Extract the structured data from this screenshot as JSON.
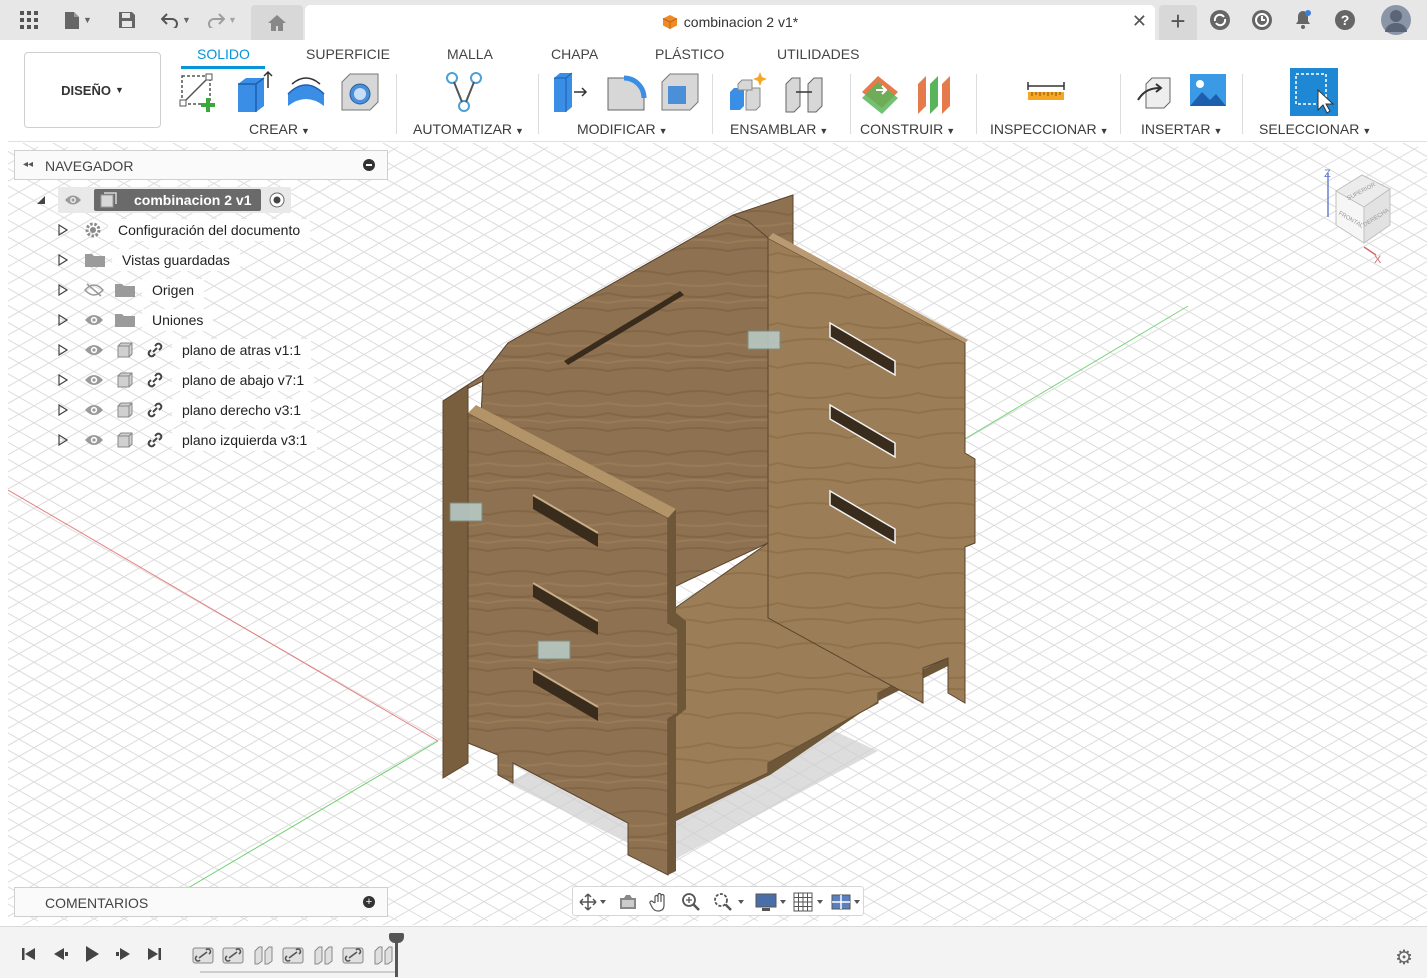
{
  "titlebar": {
    "document_title": "combinacion 2 v1*",
    "close_symbol": "✕",
    "add_tab_symbol": "+"
  },
  "ribbon": {
    "workspace_label": "DISEÑO",
    "tabs": [
      {
        "label": "SOLIDO",
        "active": true
      },
      {
        "label": "SUPERFICIE",
        "active": false
      },
      {
        "label": "MALLA",
        "active": false
      },
      {
        "label": "CHAPA",
        "active": false
      },
      {
        "label": "PLÁSTICO",
        "active": false
      },
      {
        "label": "UTILIDADES",
        "active": false
      }
    ],
    "groups": [
      {
        "label": "CREAR"
      },
      {
        "label": "AUTOMATIZAR"
      },
      {
        "label": "MODIFICAR"
      },
      {
        "label": "ENSAMBLAR"
      },
      {
        "label": "CONSTRUIR"
      },
      {
        "label": "INSPECCIONAR"
      },
      {
        "label": "INSERTAR"
      },
      {
        "label": "SELECCIONAR"
      }
    ],
    "accent": "#0696d7"
  },
  "navigator": {
    "title": "NAVEGADOR",
    "root": "combinacion 2 v1",
    "items": [
      {
        "label": "Configuración del documento",
        "icon": "gear-icon"
      },
      {
        "label": "Vistas guardadas",
        "icon": "folder-icon"
      },
      {
        "label": "Origen",
        "icon": "folder-icon",
        "hidden": true
      },
      {
        "label": "Uniones",
        "icon": "folder-icon"
      },
      {
        "label": "plano de atras v1:1",
        "icon": "component-icon"
      },
      {
        "label": "plano de abajo v7:1",
        "icon": "component-icon"
      },
      {
        "label": "plano derecho v3:1",
        "icon": "component-icon"
      },
      {
        "label": "plano izquierda v3:1",
        "icon": "component-icon"
      }
    ]
  },
  "comments": {
    "label": "COMENTARIOS"
  },
  "viewcube": {
    "top": "SUPERIOR",
    "front": "FRONTAL",
    "right": "DERECHA",
    "axis_z": "Z",
    "axis_x": "X"
  },
  "colors": {
    "wood": "#8a6d4a",
    "wood_light": "#a6875f",
    "wood_dark": "#6e5638",
    "grid": "#d9d9d9"
  }
}
